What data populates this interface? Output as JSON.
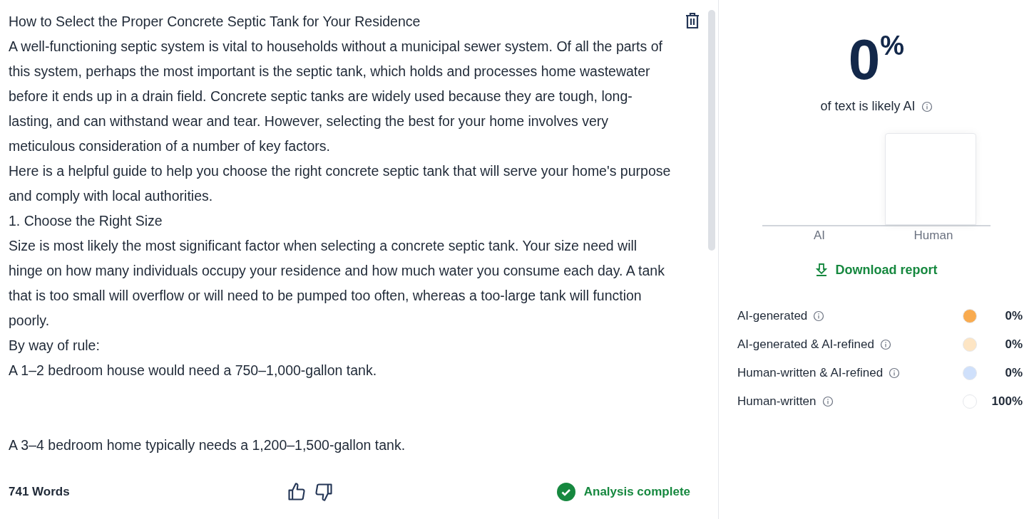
{
  "document": {
    "paragraphs": [
      {
        "text": "How to Select the Proper Concrete Septic Tank for Your Residence"
      },
      {
        "text": "A well-functioning septic system is vital to households without a municipal sewer system. Of all the parts of this system, perhaps the most important is the septic tank, which holds and processes home wastewater before it ends up in a drain field. Concrete septic tanks are widely used because they are tough, long-lasting, and can withstand wear and tear. However, selecting the best for your home involves very meticulous consideration of a number of key factors."
      },
      {
        "text": "Here is a helpful guide to help you choose the right concrete septic tank that will serve your home's purpose and comply with local authorities."
      },
      {
        "text": "1. Choose the Right Size"
      },
      {
        "text": "Size is most likely the most significant factor when selecting a concrete septic tank. Your size need will hinge on how many individuals occupy your residence and how much water you consume each day. A tank that is too small will overflow or will need to be pumped too often, whereas a too-large tank will function poorly."
      },
      {
        "text": "By way of rule:"
      },
      {
        "text": "A 1–2 bedroom house would need a 750–1,000-gallon tank.",
        "gap_after": true
      },
      {
        "text": "A 3–4 bedroom home typically needs a 1,200–1,500-gallon tank."
      }
    ]
  },
  "footer": {
    "word_count": "741 Words",
    "status": "Analysis complete"
  },
  "result": {
    "score": "0",
    "score_unit": "%",
    "caption": "of text is likely AI",
    "chart_labels": [
      "AI",
      "Human"
    ],
    "download": "Download report",
    "legend": [
      {
        "label": "AI-generated",
        "value": "0%",
        "color": "#f9ab4f"
      },
      {
        "label": "AI-generated & AI-refined",
        "value": "0%",
        "color": "#fde5c4"
      },
      {
        "label": "Human-written & AI-refined",
        "value": "0%",
        "color": "#cfe0fb"
      },
      {
        "label": "Human-written",
        "value": "100%",
        "color": "#ffffff"
      }
    ]
  }
}
